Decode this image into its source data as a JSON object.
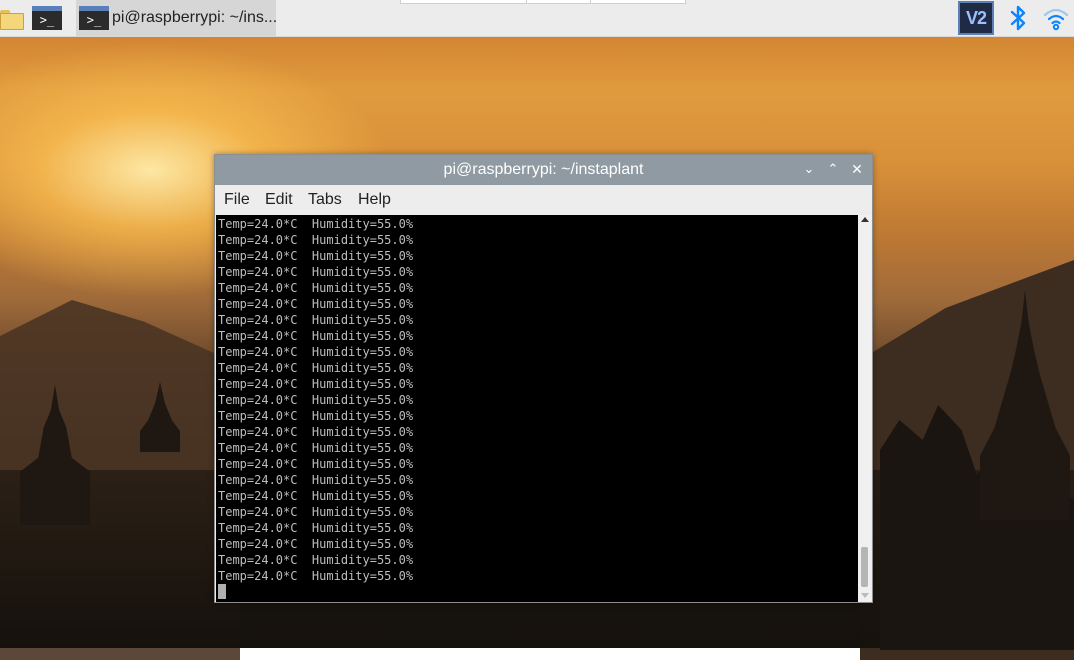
{
  "taskbar": {
    "launchers": [
      {
        "name": "file-manager",
        "icon": "folder-icon"
      },
      {
        "name": "terminal",
        "icon": "terminal-icon",
        "glyph": ">_"
      }
    ],
    "task": {
      "icon": "terminal-icon",
      "glyph": ">_",
      "title": "pi@raspberrypi: ~/ins..."
    },
    "tray": {
      "vnc": {
        "icon": "vnc-icon",
        "label": "V2"
      },
      "bluetooth": {
        "icon": "bluetooth-icon"
      },
      "wifi": {
        "icon": "wifi-icon"
      }
    }
  },
  "window": {
    "title": "pi@raspberrypi: ~/instaplant",
    "controls": {
      "minimize": "⌄",
      "maximize": "⌃",
      "close": "✕"
    },
    "menu": {
      "file": "File",
      "edit": "Edit",
      "tabs": "Tabs",
      "help": "Help"
    },
    "output_lines": [
      "Temp=24.0*C  Humidity=55.0%",
      "Temp=24.0*C  Humidity=55.0%",
      "Temp=24.0*C  Humidity=55.0%",
      "Temp=24.0*C  Humidity=55.0%",
      "Temp=24.0*C  Humidity=55.0%",
      "Temp=24.0*C  Humidity=55.0%",
      "Temp=24.0*C  Humidity=55.0%",
      "Temp=24.0*C  Humidity=55.0%",
      "Temp=24.0*C  Humidity=55.0%",
      "Temp=24.0*C  Humidity=55.0%",
      "Temp=24.0*C  Humidity=55.0%",
      "Temp=24.0*C  Humidity=55.0%",
      "Temp=24.0*C  Humidity=55.0%",
      "Temp=24.0*C  Humidity=55.0%",
      "Temp=24.0*C  Humidity=55.0%",
      "Temp=24.0*C  Humidity=55.0%",
      "Temp=24.0*C  Humidity=55.0%",
      "Temp=24.0*C  Humidity=55.0%",
      "Temp=24.0*C  Humidity=55.0%",
      "Temp=24.0*C  Humidity=55.0%",
      "Temp=24.0*C  Humidity=55.0%",
      "Temp=24.0*C  Humidity=55.0%",
      "Temp=24.0*C  Humidity=55.0%"
    ]
  },
  "colors": {
    "titlebar": "#8f9aa3",
    "terminal_bg": "#000000",
    "terminal_fg": "#bdbdbd",
    "taskbar": "#ececec",
    "accent": "#0a84ff"
  }
}
